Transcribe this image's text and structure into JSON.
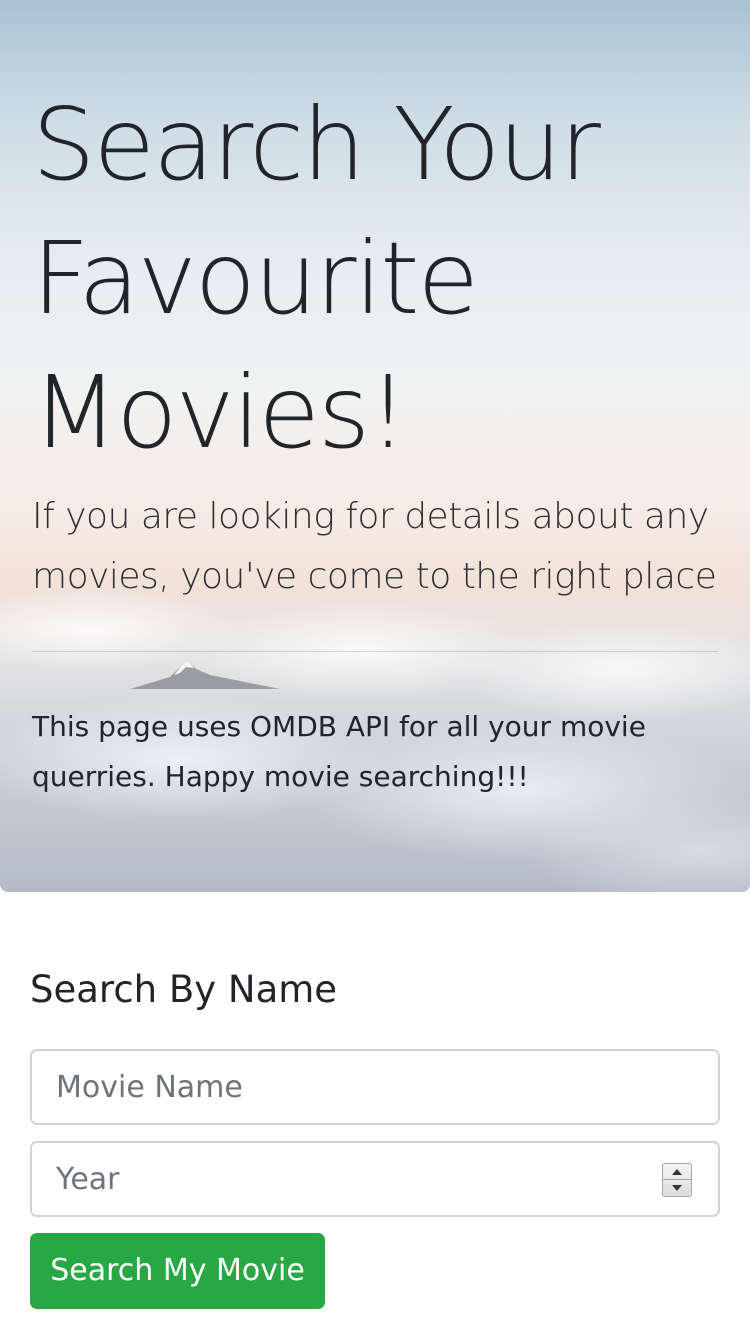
{
  "hero": {
    "title": "Search Your Favourite Movies!",
    "lead": "If you are looking for details about any movies, you've come to the right place",
    "note": "This page uses OMDB API for all your movie querries. Happy movie searching!!!"
  },
  "search": {
    "heading": "Search By Name",
    "name_placeholder": "Movie Name",
    "year_placeholder": "Year",
    "button_label": "Search My Movie"
  },
  "colors": {
    "button_bg": "#28a745",
    "input_border": "#ced4da",
    "text": "#212529"
  },
  "icons": {
    "year_stepper_up": "triangle-up-icon",
    "year_stepper_down": "triangle-down-icon"
  }
}
